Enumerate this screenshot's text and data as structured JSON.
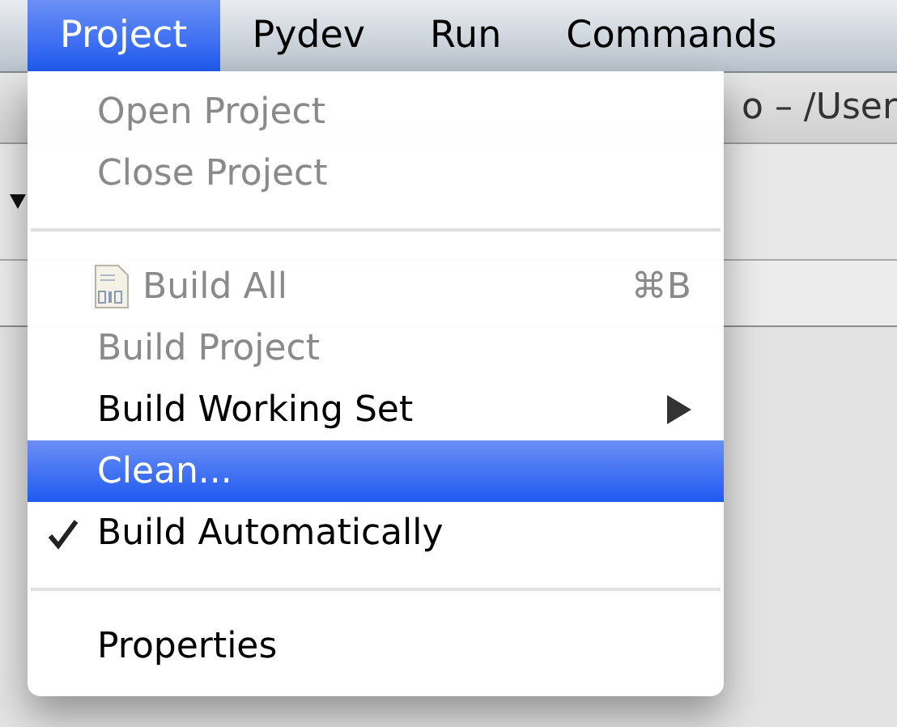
{
  "menubar": {
    "items": [
      {
        "label": "Project",
        "selected": true
      },
      {
        "label": "Pydev",
        "selected": false
      },
      {
        "label": "Run",
        "selected": false
      },
      {
        "label": "Commands",
        "selected": false
      }
    ]
  },
  "window": {
    "title": "o – /User"
  },
  "menu": {
    "items": [
      {
        "kind": "item",
        "label": "Open Project",
        "disabled": true,
        "selected": false,
        "checked": false
      },
      {
        "kind": "item",
        "label": "Close Project",
        "disabled": true,
        "selected": false,
        "checked": false
      },
      {
        "kind": "separator"
      },
      {
        "kind": "item",
        "label": "Build All",
        "disabled": true,
        "selected": false,
        "checked": false,
        "has_icon": true,
        "shortcut": "⌘B"
      },
      {
        "kind": "item",
        "label": "Build Project",
        "disabled": true,
        "selected": false,
        "checked": false
      },
      {
        "kind": "item",
        "label": "Build Working Set",
        "disabled": false,
        "selected": false,
        "checked": false,
        "submenu": true
      },
      {
        "kind": "item",
        "label": "Clean...",
        "disabled": false,
        "selected": true,
        "checked": false
      },
      {
        "kind": "item",
        "label": "Build Automatically",
        "disabled": false,
        "selected": false,
        "checked": true
      },
      {
        "kind": "separator"
      },
      {
        "kind": "item",
        "label": "Properties",
        "disabled": false,
        "selected": false,
        "checked": false
      }
    ]
  }
}
